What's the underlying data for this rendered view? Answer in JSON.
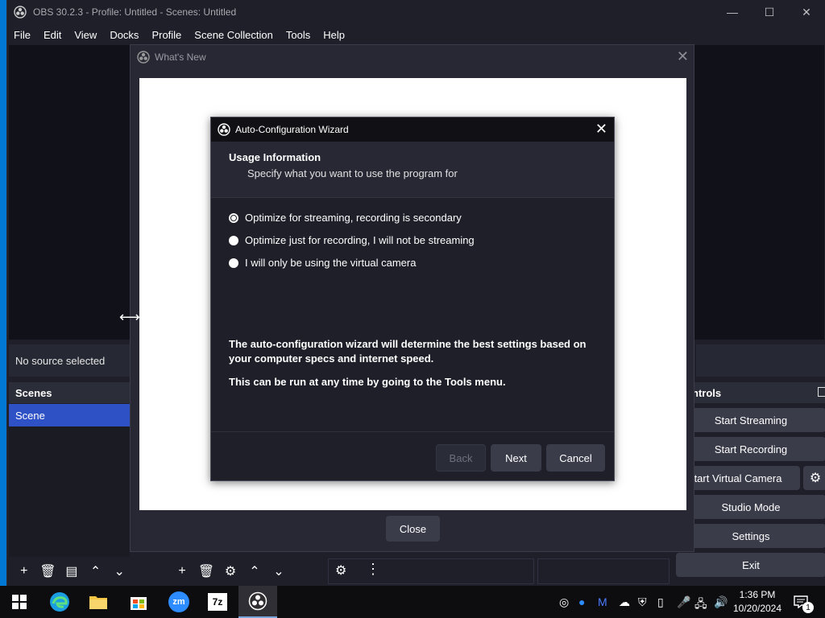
{
  "window": {
    "title": "OBS 30.2.3 - Profile: Untitled - Scenes: Untitled",
    "controls": {
      "minimize": "—",
      "maximize": "☐",
      "close": "✕"
    }
  },
  "menu": [
    "File",
    "Edit",
    "View",
    "Docks",
    "Profile",
    "Scene Collection",
    "Tools",
    "Help"
  ],
  "sources": {
    "status": "No source selected"
  },
  "scenes": {
    "title": "Scenes",
    "items": [
      "Scene"
    ]
  },
  "controls": {
    "title": "ntrols",
    "buttons": [
      "Start Streaming",
      "Start Recording",
      "tart Virtual Camera",
      "Studio Mode",
      "Settings",
      "Exit"
    ]
  },
  "whats_new": {
    "title": "What's New",
    "close_button": "Close"
  },
  "wizard": {
    "title": "Auto-Configuration Wizard",
    "heading": "Usage Information",
    "subheading": "Specify what you want to use the program for",
    "options": [
      {
        "label": "Optimize for streaming, recording is secondary",
        "selected": true
      },
      {
        "label": "Optimize just for recording, I will not be streaming",
        "selected": false
      },
      {
        "label": "I will only be using the virtual camera",
        "selected": false
      }
    ],
    "info1": "The auto-configuration wizard will determine the best settings based on your computer specs and internet speed.",
    "info2": "This can be run at any time by going to the Tools menu.",
    "buttons": {
      "back": "Back",
      "next": "Next",
      "cancel": "Cancel"
    }
  },
  "taskbar": {
    "apps": [
      "windows-start",
      "edge",
      "file-explorer",
      "microsoft-store",
      "zoom",
      "7zip",
      "obs"
    ],
    "zoom_label": "zm",
    "sevenzip_label": "7z",
    "clock_time": "1:36 PM",
    "clock_date": "10/20/2024",
    "notification_count": "1"
  },
  "colors": {
    "accent": "#2f51c6",
    "background": "#1e1f29",
    "desktop": "#0078d4"
  }
}
